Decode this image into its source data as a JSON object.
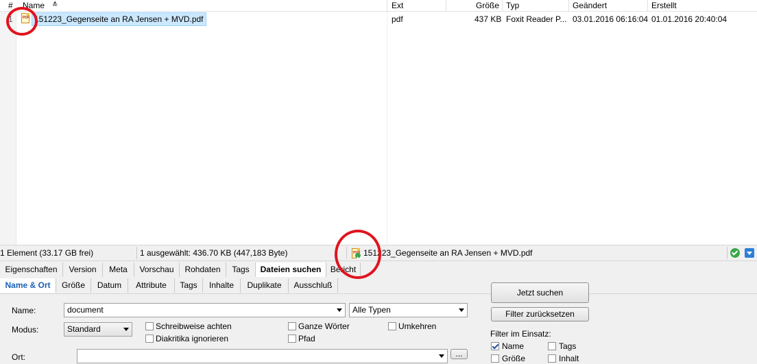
{
  "columns": {
    "num": "#",
    "name": "Name",
    "ext": "Ext",
    "size": "Größe",
    "type": "Typ",
    "modified": "Geändert",
    "created": "Erstellt"
  },
  "row": {
    "index": "1",
    "name": "151223_Gegenseite an RA Jensen + MVD.pdf",
    "ext": "pdf",
    "size": "437 KB",
    "type": "Foxit Reader P...",
    "modified": "03.01.2016 06:16:04",
    "created": "01.01.2016 20:40:04"
  },
  "status": {
    "items": "1 Element (33.17 GB frei)",
    "selected": "1 ausgewählt: 436.70 KB (447,183 Byte)",
    "file": "151223_Gegenseite an RA Jensen + MVD.pdf"
  },
  "info_tabs": [
    "Eigenschaften",
    "Version",
    "Meta",
    "Vorschau",
    "Rohdaten",
    "Tags",
    "Dateien suchen",
    "Bericht"
  ],
  "search_tabs": [
    "Name & Ort",
    "Größe",
    "Datum",
    "Attribute",
    "Tags",
    "Inhalte",
    "Duplikate",
    "Ausschluß"
  ],
  "form": {
    "name_label": "Name:",
    "name_value": "document",
    "type_value": "Alle Typen",
    "mode_label": "Modus:",
    "mode_value": "Standard",
    "case": "Schreibweise achten",
    "diacritics": "Diakritika ignorieren",
    "whole_words": "Ganze Wörter",
    "path": "Pfad",
    "invert": "Umkehren",
    "location_label": "Ort:",
    "browse": "..."
  },
  "buttons": {
    "search_now": "Jetzt suchen",
    "reset_filter": "Filter zurücksetzen"
  },
  "filters": {
    "heading": "Filter im Einsatz:",
    "name": "Name",
    "tags": "Tags",
    "size": "Größe",
    "content": "Inhalt"
  },
  "colors": {
    "selection": "#cce8ff",
    "annotation": "#e0141e",
    "accent": "#1a5fb4"
  }
}
